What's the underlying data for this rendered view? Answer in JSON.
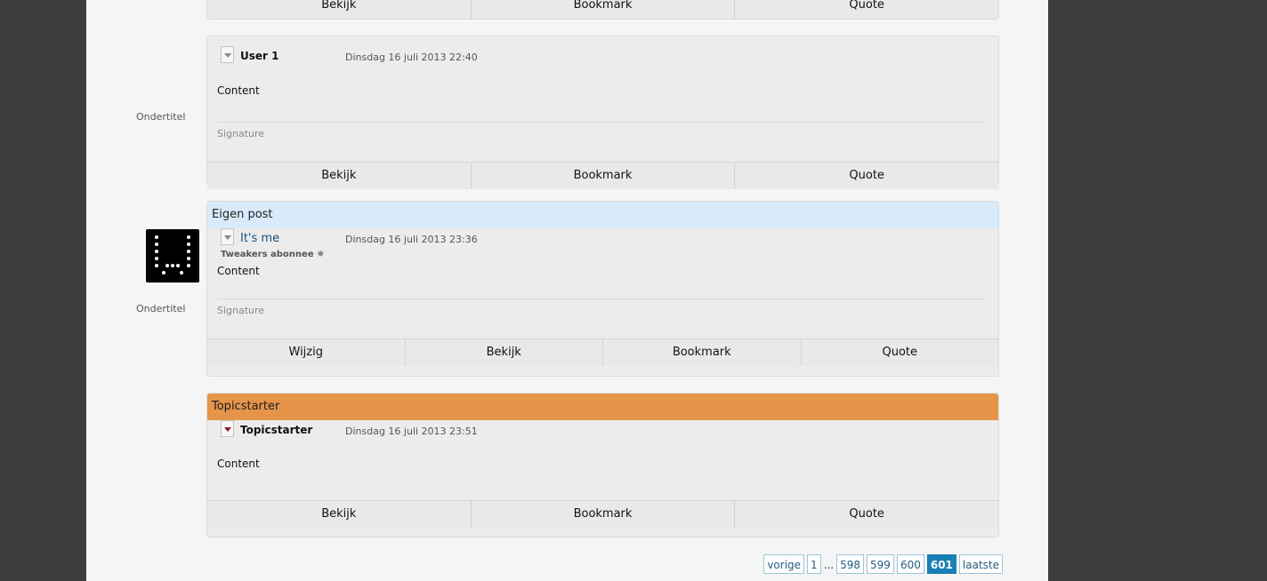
{
  "posts": [
    {
      "actions": [
        "Bekijk",
        "Bookmark",
        "Quote"
      ]
    },
    {
      "subtitle": "Ondertitel",
      "username": "User 1",
      "date": "Dinsdag 16 juli 2013 22:40",
      "content": "Content",
      "signature": "Signature",
      "actions": [
        "Bekijk",
        "Bookmark",
        "Quote"
      ]
    },
    {
      "banner": "Eigen post",
      "subtitle": "Ondertitel",
      "username": "It's me",
      "userstatus": "Tweakers abonnee",
      "date": "Dinsdag 16 juli 2013 23:36",
      "content": "Content",
      "signature": "Signature",
      "actions": [
        "Wijzig",
        "Bekijk",
        "Bookmark",
        "Quote"
      ]
    },
    {
      "banner": "Topicstarter",
      "username": "Topicstarter",
      "date": "Dinsdag 16 juli 2013 23:51",
      "content": "Content",
      "actions": [
        "Bekijk",
        "Bookmark",
        "Quote"
      ]
    }
  ],
  "pagination": {
    "prev": "vorige",
    "pages": [
      "1",
      "598",
      "599",
      "600",
      "601"
    ],
    "ellipsis": "...",
    "current": "601",
    "last": "laatste"
  }
}
